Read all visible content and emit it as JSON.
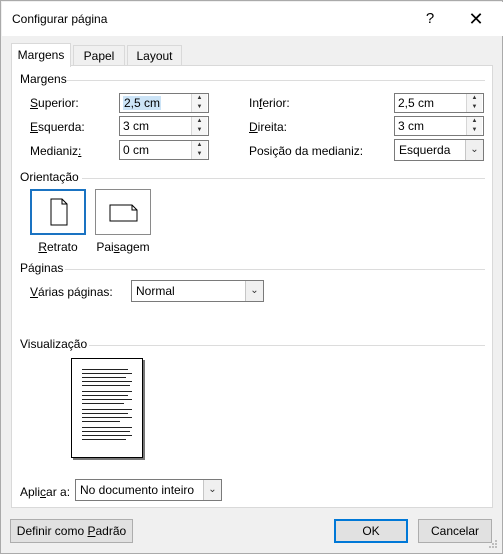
{
  "window": {
    "title": "Configurar página",
    "help_glyph": "?",
    "close_glyph": "✕"
  },
  "tabs": [
    {
      "label": "Margens",
      "active": true
    },
    {
      "label": "Papel",
      "active": false
    },
    {
      "label": "Layout",
      "active": false
    }
  ],
  "margins": {
    "group_label": "Margens",
    "superior": {
      "label_u": "S",
      "label_rest": "uperior:",
      "value": "2,5 cm"
    },
    "inferior": {
      "label_pre": "In",
      "label_u": "f",
      "label_rest": "erior:",
      "value": "2,5 cm"
    },
    "esquerda": {
      "label_u": "E",
      "label_rest": "squerda:",
      "value": "3 cm"
    },
    "direita": {
      "label_u": "D",
      "label_rest": "ireita:",
      "value": "3 cm"
    },
    "medianiz": {
      "label_pre": "Medianiz",
      "label_u": ":",
      "label_rest": "",
      "value": "0 cm"
    },
    "posicao_medianiz": {
      "label": "Posição da medianiz:",
      "value": "Esquerda"
    }
  },
  "orientation": {
    "group_label": "Orientação",
    "retrato": {
      "label_u": "R",
      "label_rest": "etrato"
    },
    "paisagem": {
      "label_pre": "Pai",
      "label_u": "s",
      "label_rest": "agem"
    }
  },
  "pages": {
    "group_label": "Páginas",
    "varias_label_u": "V",
    "varias_label_rest": "árias páginas:",
    "varias_value": "Normal"
  },
  "preview": {
    "group_label": "Visualização"
  },
  "apply": {
    "label_pre": "Apli",
    "label_u": "c",
    "label_rest": "ar a:",
    "value": "No documento inteiro"
  },
  "buttons": {
    "default_pre": "Definir como ",
    "default_u": "P",
    "default_rest": "adrão",
    "ok": "OK",
    "cancel": "Cancelar"
  }
}
